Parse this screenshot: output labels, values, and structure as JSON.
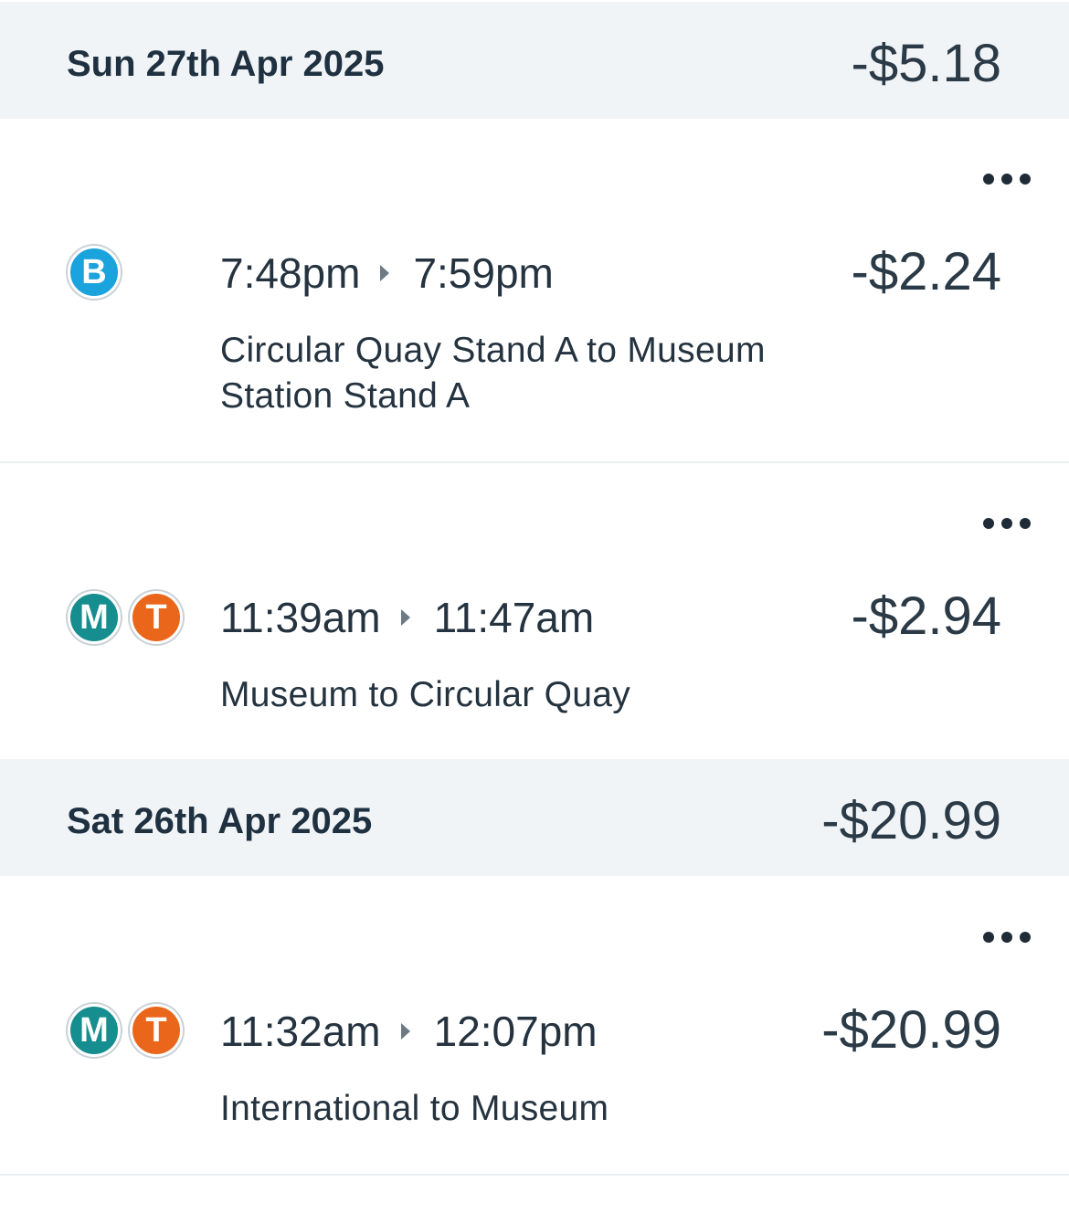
{
  "days": [
    {
      "date": "Sun 27th Apr 2025",
      "total": "-$5.18",
      "trips": [
        {
          "modes": [
            {
              "letter": "B",
              "icon": "bus-icon",
              "color": "#1aa3dc"
            }
          ],
          "depart": "7:48pm",
          "arrive": "7:59pm",
          "fare": "-$2.24",
          "route": "Circular Quay Stand A to Museum Station Stand A"
        },
        {
          "modes": [
            {
              "letter": "M",
              "icon": "metro-icon",
              "color": "#168d8e"
            },
            {
              "letter": "T",
              "icon": "train-icon",
              "color": "#e9661a"
            }
          ],
          "depart": "11:39am",
          "arrive": "11:47am",
          "fare": "-$2.94",
          "route": "Museum to Circular Quay"
        }
      ]
    },
    {
      "date": "Sat 26th Apr 2025",
      "total": "-$20.99",
      "trips": [
        {
          "modes": [
            {
              "letter": "M",
              "icon": "metro-icon",
              "color": "#168d8e"
            },
            {
              "letter": "T",
              "icon": "train-icon",
              "color": "#e9661a"
            }
          ],
          "depart": "11:32am",
          "arrive": "12:07pm",
          "fare": "-$20.99",
          "route": "International to Museum"
        }
      ]
    }
  ],
  "colors": {
    "header_background": "#f1f4f6",
    "text": "#1f3140",
    "bus": "#1aa3dc",
    "metro": "#168d8e",
    "train": "#e9661a"
  }
}
